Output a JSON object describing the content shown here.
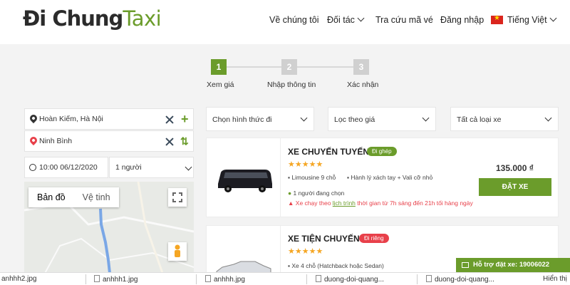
{
  "header": {
    "logo_part1": "Đi Chung",
    "logo_part2": "Taxi",
    "nav": {
      "about": "Về chúng tôi",
      "partners": "Đối tác",
      "ticket_lookup": "Tra cứu mã vé",
      "login": "Đăng nhập",
      "language": "Tiếng Việt"
    }
  },
  "steps": [
    {
      "num": "1",
      "label": "Xem giá"
    },
    {
      "num": "2",
      "label": "Nhập thông tin"
    },
    {
      "num": "3",
      "label": "Xác nhận"
    }
  ],
  "search": {
    "origin": "Hoàn Kiếm, Hà Nội",
    "destination": "Ninh Bình",
    "datetime": "10:00 06/12/2020",
    "passengers": "1 người"
  },
  "map": {
    "tab_map": "Bản đồ",
    "tab_satellite": "Vệ tinh"
  },
  "filters": {
    "trip_type": "Chọn hình thức đi",
    "price": "Lọc theo giá",
    "vehicle": "Tất cả loại xe"
  },
  "cards": [
    {
      "title": "XE CHUYẾN TUYẾN",
      "badge": "Đi ghép",
      "stars": "★★★★★",
      "spec1": "Limousine 9 chỗ",
      "spec2": "Hành lý xách tay + Vali cỡ nhỏ",
      "selected": "1 người đang chọn",
      "warning_prefix": "Xe chạy theo ",
      "warning_link": "lịch trình",
      "warning_suffix": " thời gian từ 7h sáng đến 21h tối hàng ngày",
      "price": "135.000 ₫",
      "book": "ĐẶT XE"
    },
    {
      "title": "XE TIỆN CHUYẾN",
      "badge": "Đi riêng",
      "stars": "★★★★★",
      "spec1": "Xe 4 chỗ (Hatchback hoặc Sedan)"
    }
  ],
  "support": "Hỗ trợ đặt xe: 19006022",
  "downloads": [
    "anhhh2.jpg",
    "anhhh1.jpg",
    "anhhh.jpg",
    "duong-doi-quang...",
    "duong-doi-quang...",
    "Hiển thị"
  ],
  "colors": {
    "brand_green": "#6b9c2b",
    "badge_green": "#6b9c2b",
    "badge_red": "#e8404a",
    "star": "#f5a623"
  }
}
